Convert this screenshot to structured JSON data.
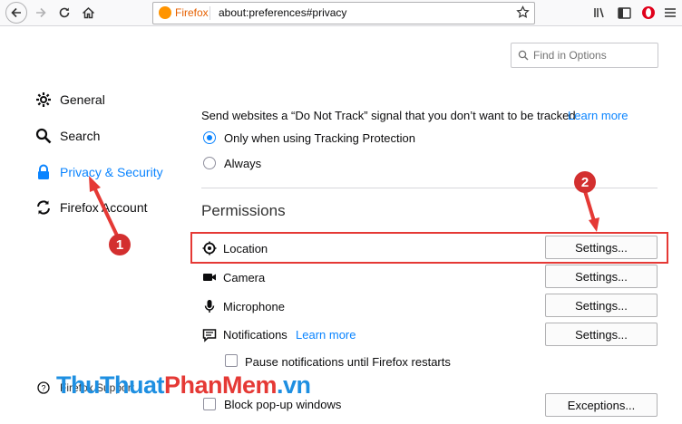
{
  "browser": {
    "url_brand": "Firefox",
    "url": "about:preferences#privacy",
    "icons": [
      "back-icon",
      "forward-icon",
      "reload-icon",
      "home-icon",
      "bookmark-star-icon",
      "library-icon",
      "sidebar-icon",
      "opera-like-addon-icon",
      "hamburger-menu-icon"
    ]
  },
  "search": {
    "placeholder": "Find in Options"
  },
  "sidebar": {
    "items": [
      {
        "label": "General",
        "icon": "gear-icon",
        "selected": false
      },
      {
        "label": "Search",
        "icon": "search-icon",
        "selected": false
      },
      {
        "label": "Privacy & Security",
        "icon": "lock-icon",
        "selected": true
      },
      {
        "label": "Firefox Account",
        "icon": "sync-icon",
        "selected": false
      }
    ],
    "support_label": "Firefox Support"
  },
  "tracking": {
    "dnt_text": "Send websites a “Do Not Track” signal that you don’t want to be tracked",
    "learn_more": "Learn more",
    "options": [
      {
        "label": "Only when using Tracking Protection",
        "checked": true
      },
      {
        "label": "Always",
        "checked": false
      }
    ]
  },
  "permissions": {
    "title": "Permissions",
    "rows": [
      {
        "label": "Location",
        "icon": "location-icon",
        "button": "Settings..."
      },
      {
        "label": "Camera",
        "icon": "camera-icon",
        "button": "Settings..."
      },
      {
        "label": "Microphone",
        "icon": "microphone-icon",
        "button": "Settings..."
      },
      {
        "label": "Notifications",
        "icon": "notification-icon",
        "button": "Settings...",
        "link": "Learn more"
      }
    ],
    "pause_label": "Pause notifications until Firefox restarts",
    "popup_label": "Block pop-up windows",
    "popup_button": "Exceptions..."
  },
  "annotations": {
    "badge1": "1",
    "badge2": "2"
  },
  "watermark": {
    "part1": "ThuThuat",
    "part2": "PhanMem",
    "part3": ".vn"
  },
  "colors": {
    "accent": "#0a84ff",
    "annotation": "#e53935"
  }
}
